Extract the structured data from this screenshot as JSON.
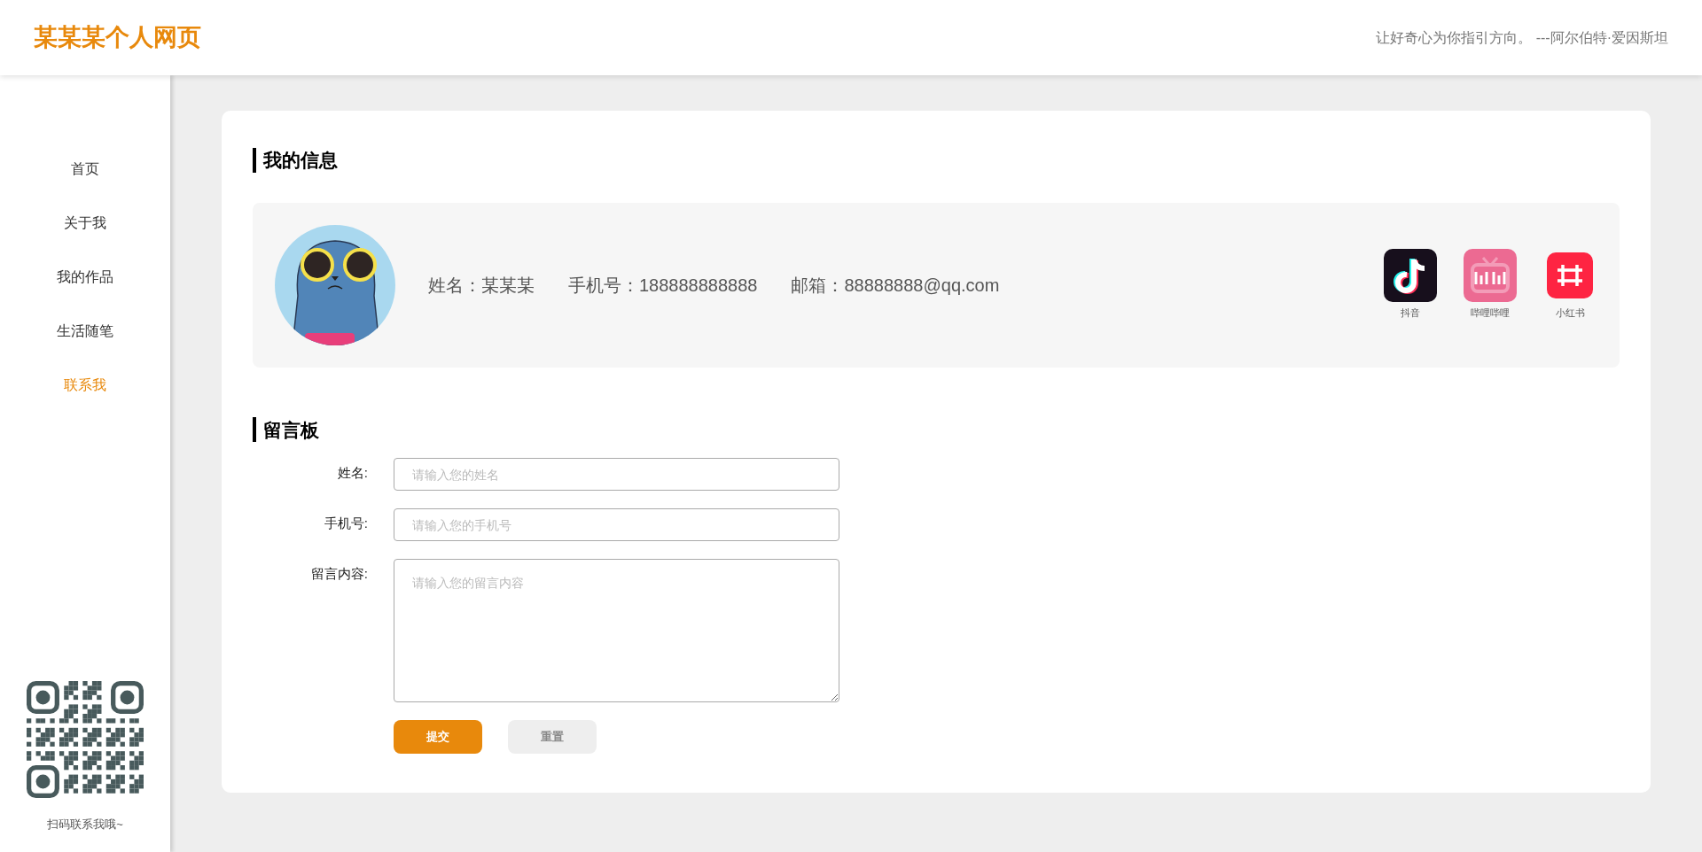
{
  "header": {
    "title": "某某某个人网页",
    "quote": "让好奇心为你指引方向。 ---阿尔伯特·爱因斯坦"
  },
  "nav": [
    {
      "label": "首页",
      "selected": false
    },
    {
      "label": "关于我",
      "selected": false
    },
    {
      "label": "我的作品",
      "selected": false
    },
    {
      "label": "生活随笔",
      "selected": false
    },
    {
      "label": "联系我",
      "selected": true
    }
  ],
  "qr": {
    "caption": "扫码联系我哦~"
  },
  "profile": {
    "heading": "我的信息",
    "fields": [
      "姓名：某某某",
      "手机号：188888888888",
      "邮箱：88888888@qq.com"
    ],
    "socials": [
      {
        "kind": "douyin",
        "label": "抖音"
      },
      {
        "kind": "bilibili",
        "label": "哔哩哔哩"
      },
      {
        "kind": "xiaohongshu",
        "label": "小红书"
      }
    ]
  },
  "guestbook": {
    "heading": "留言板",
    "fields": [
      {
        "kind": "input",
        "label": "姓名:",
        "placeholder": "请输入您的姓名"
      },
      {
        "kind": "input",
        "label": "手机号:",
        "placeholder": "请输入您的手机号"
      },
      {
        "kind": "textarea",
        "label": "留言内容:",
        "placeholder": "请输入您的留言内容"
      }
    ],
    "buttons": [
      {
        "kind": "primary",
        "label": "提交"
      },
      {
        "kind": "secondary",
        "label": "重置"
      }
    ]
  }
}
